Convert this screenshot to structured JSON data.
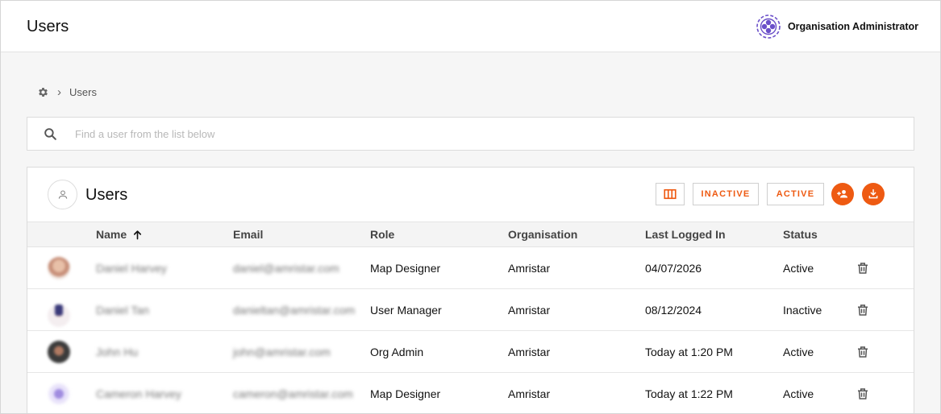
{
  "header": {
    "title": "Users",
    "role_label": "Organisation Administrator"
  },
  "breadcrumb": {
    "current": "Users"
  },
  "search": {
    "placeholder": "Find a user from the list below"
  },
  "panel": {
    "title": "Users",
    "inactive_label": "INACTIVE",
    "active_label": "ACTIVE"
  },
  "table": {
    "columns": {
      "name": "Name",
      "email": "Email",
      "role": "Role",
      "organisation": "Organisation",
      "last_logged_in": "Last Logged In",
      "status": "Status"
    },
    "rows": [
      {
        "name": "Daniel Harvey",
        "email": "daniel@amristar.com",
        "role": "Map Designer",
        "organisation": "Amristar",
        "last_logged_in": "04/07/2026",
        "status": "Active"
      },
      {
        "name": "Daniel Tan",
        "email": "danieltan@amristar.com",
        "role": "User Manager",
        "organisation": "Amristar",
        "last_logged_in": "08/12/2024",
        "status": "Inactive"
      },
      {
        "name": "John Hu",
        "email": "john@amristar.com",
        "role": "Org Admin",
        "organisation": "Amristar",
        "last_logged_in": "Today at 1:20 PM",
        "status": "Active"
      },
      {
        "name": "Cameron Harvey",
        "email": "cameron@amristar.com",
        "role": "Map Designer",
        "organisation": "Amristar",
        "last_logged_in": "Today at 1:22 PM",
        "status": "Active"
      }
    ]
  },
  "colors": {
    "accent": "#ee5a12",
    "logo": "#6a4fc9"
  },
  "icons": {
    "breadcrumb_root": "gear-icon",
    "search": "search-icon",
    "panel": "person-icon",
    "columns": "view-columns-icon",
    "add_user": "add-user-icon",
    "download": "download-icon",
    "sort": "arrow-up-icon",
    "row_action": "trash-icon"
  }
}
